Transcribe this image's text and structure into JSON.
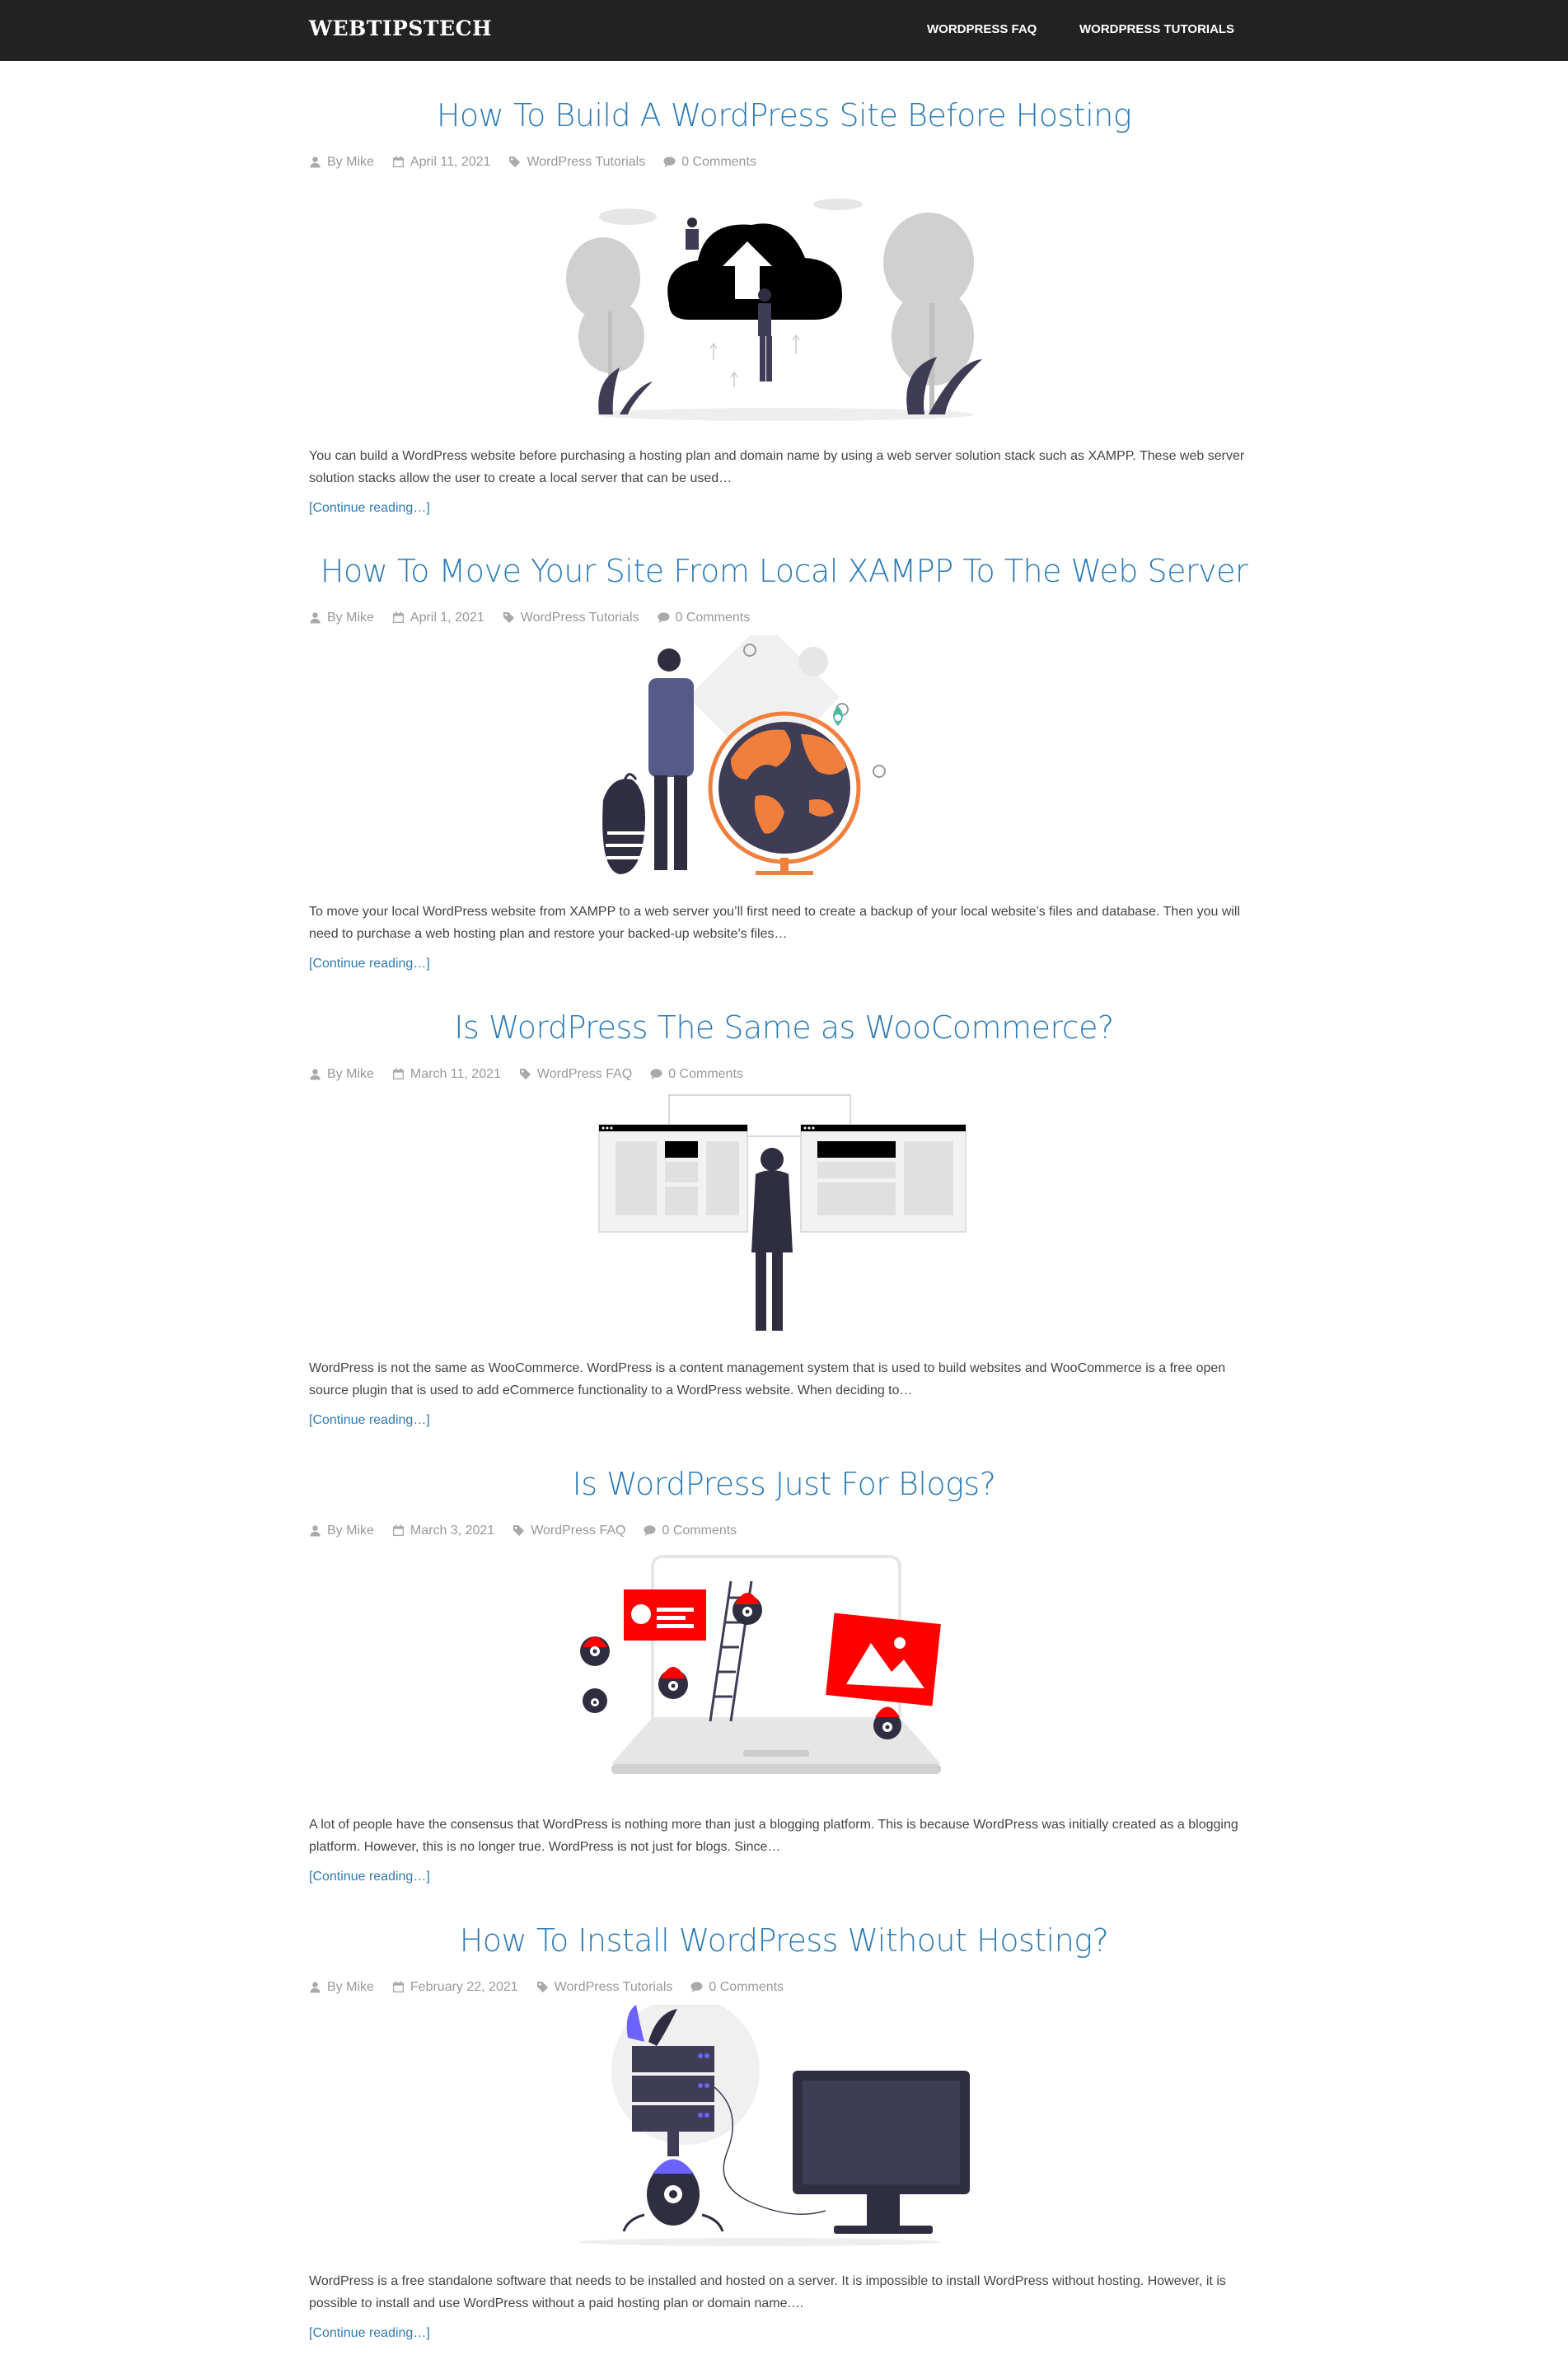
{
  "site": {
    "title": "WEBTIPSTECH"
  },
  "nav": {
    "items": [
      "WORDPRESS FAQ",
      "WORDPRESS TUTORIALS"
    ]
  },
  "posts": [
    {
      "title": "How To Build A WordPress Site Before Hosting",
      "author": "By Mike",
      "date": "April 11, 2021",
      "category": "WordPress Tutorials",
      "comments": "0 Comments",
      "excerpt": "You can build a WordPress website before purchasing a hosting plan and domain name by using a web server solution stack such as XAMPP. These web server solution stacks allow the user to create a local server that can be used…",
      "more": "[Continue reading…]"
    },
    {
      "title": "How To Move Your Site From Local XAMPP To The Web Server",
      "author": "By Mike",
      "date": "April 1, 2021",
      "category": "WordPress Tutorials",
      "comments": "0 Comments",
      "excerpt": "To move your local WordPress website from XAMPP to a web server you’ll first need to create a backup of your local website’s files and database. Then you will need to purchase a web hosting plan and restore your backed-up website’s files…",
      "more": "[Continue reading…]"
    },
    {
      "title": "Is WordPress The Same as WooCommerce?",
      "author": "By Mike",
      "date": "March 11, 2021",
      "category": "WordPress FAQ",
      "comments": "0 Comments",
      "excerpt": "WordPress is not the same as WooCommerce. WordPress is a content management system that is used to build websites and WooCommerce is a free open source plugin that is used to add eCommerce functionality to a WordPress website. When deciding to…",
      "more": "[Continue reading…]"
    },
    {
      "title": "Is WordPress Just For Blogs?",
      "author": "By Mike",
      "date": "March 3, 2021",
      "category": "WordPress FAQ",
      "comments": "0 Comments",
      "excerpt": "A lot of people have the consensus that WordPress is nothing more than just a blogging platform. This is because WordPress was initially created as a blogging platform. However, this is no longer true.  WordPress is not just for blogs. Since…",
      "more": "[Continue reading…]"
    },
    {
      "title": "How To Install WordPress Without Hosting?",
      "author": "By Mike",
      "date": "February 22, 2021",
      "category": "WordPress Tutorials",
      "comments": "0 Comments",
      "excerpt": "WordPress is a free standalone software that needs to be installed and hosted on a server. It is impossible to install WordPress without hosting. However, it is possible to install and use WordPress without a paid hosting plan or domain name.…",
      "more": "[Continue reading…]"
    }
  ],
  "colors": {
    "header": "#222222",
    "link": "#2d7bb6",
    "meta": "#999999",
    "text": "#444444"
  },
  "icons": [
    "user-icon",
    "calendar-icon",
    "tag-icon",
    "comment-icon"
  ]
}
